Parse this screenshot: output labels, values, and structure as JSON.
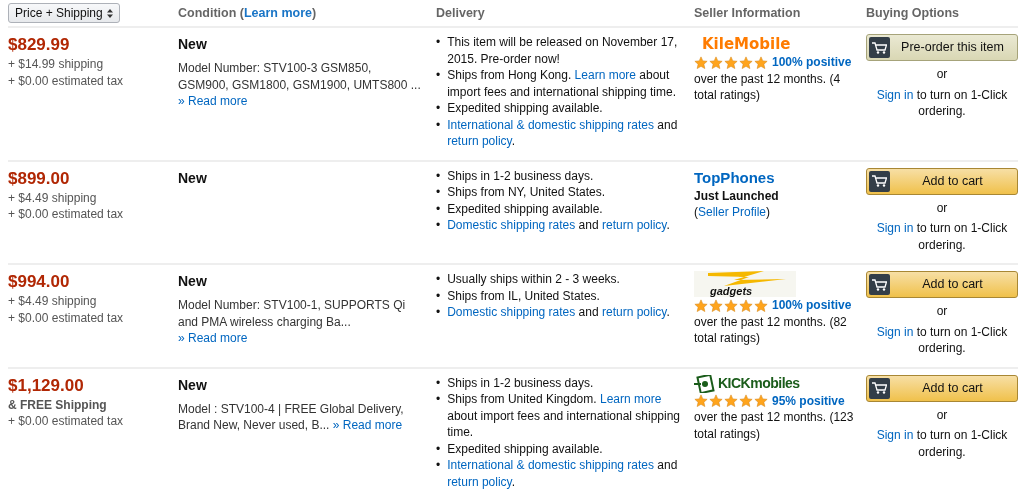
{
  "header": {
    "sort": {
      "label": "Price + Shipping"
    },
    "columns": [
      {
        "segments": [
          {
            "text": "Condition ("
          },
          {
            "text": "Learn more",
            "link": true
          },
          {
            "text": ")"
          }
        ]
      },
      {
        "segments": [
          {
            "text": "Delivery"
          }
        ]
      },
      {
        "segments": [
          {
            "text": "Seller Information"
          }
        ]
      },
      {
        "segments": [
          {
            "text": "Buying Options"
          }
        ]
      }
    ]
  },
  "offers": [
    {
      "price": "$829.99",
      "shipping": {
        "kind": "paid",
        "text": "+ $14.99 shipping"
      },
      "tax": "+ $0.00 estimated tax",
      "condition": "New",
      "description": "Model Number: STV100-3 GSM850, GSM900, GSM1800, GSM1900, UMTS800 ...",
      "read_more": "» Read more",
      "read_more_block": true,
      "delivery": [
        {
          "bullet": "•",
          "segments": [
            {
              "text": "This item will be released on November 17, 2015. Pre-order now!"
            }
          ]
        },
        {
          "bullet": "•",
          "segments": [
            {
              "text": "Ships from Hong Kong. "
            },
            {
              "text": "Learn more",
              "link": true
            },
            {
              "text": " about import fees and international shipping time."
            }
          ]
        },
        {
          "bullet": "•",
          "segments": [
            {
              "text": "Expedited shipping available."
            }
          ]
        },
        {
          "bullet": "•",
          "segments": [
            {
              "text": "International & domestic shipping rates",
              "link": true
            },
            {
              "text": " and "
            },
            {
              "text": "return policy",
              "link": true
            },
            {
              "text": "."
            }
          ]
        }
      ],
      "seller": {
        "kind": "text_logo",
        "name": "KileMobile",
        "stars": 5,
        "positive": "100% positive",
        "note": "over the past 12 months. (4 total ratings)"
      },
      "button": {
        "kind": "preorder",
        "label": "Pre-order this item"
      },
      "or": "or",
      "signin": [
        {
          "text": "Sign in",
          "link": true
        },
        {
          "text": " to turn on 1-Click ordering."
        }
      ]
    },
    {
      "price": "$899.00",
      "shipping": {
        "kind": "paid",
        "text": "+ $4.49 shipping"
      },
      "tax": "+ $0.00 estimated tax",
      "condition": "New",
      "delivery": [
        {
          "bullet": "•",
          "segments": [
            {
              "text": "Ships in 1-2 business days."
            }
          ]
        },
        {
          "bullet": "•",
          "segments": [
            {
              "text": "Ships from NY, United States."
            }
          ]
        },
        {
          "bullet": "•",
          "segments": [
            {
              "text": "Expedited shipping available."
            }
          ]
        },
        {
          "bullet": "•",
          "segments": [
            {
              "text": "Domestic shipping rates",
              "link": true
            },
            {
              "text": " and "
            },
            {
              "text": "return policy",
              "link": true
            },
            {
              "text": "."
            }
          ]
        }
      ],
      "seller": {
        "kind": "name",
        "name": "TopPhones",
        "status": [
          {
            "text": "Just Launched",
            "bold": true
          },
          {
            "text": " ("
          },
          {
            "text": "Seller Profile",
            "link": true
          },
          {
            "text": ")"
          }
        ]
      },
      "button": {
        "kind": "cart",
        "label": "Add to cart"
      },
      "or": "or",
      "signin": [
        {
          "text": "Sign in",
          "link": true
        },
        {
          "text": " to turn on 1-Click ordering."
        }
      ]
    },
    {
      "price": "$994.00",
      "shipping": {
        "kind": "paid",
        "text": "+ $4.49 shipping"
      },
      "tax": "+ $0.00 estimated tax",
      "condition": "New",
      "description": "Model Number: STV100-1, SUPPORTS Qi and PMA wireless charging Ba...",
      "read_more": "» Read more",
      "read_more_block": true,
      "delivery": [
        {
          "bullet": "•",
          "segments": [
            {
              "text": "Usually ships within 2 - 3 weeks."
            }
          ]
        },
        {
          "bullet": "•",
          "segments": [
            {
              "text": "Ships from IL, United States."
            }
          ]
        },
        {
          "bullet": "•",
          "segments": [
            {
              "text": "Domestic shipping rates",
              "link": true
            },
            {
              "text": " and "
            },
            {
              "text": "return policy",
              "link": true
            },
            {
              "text": "."
            }
          ]
        }
      ],
      "seller": {
        "kind": "banner_logo",
        "name": "gadgets",
        "stars": 5,
        "positive": "100% positive",
        "note": "over the past 12 months. (82 total ratings)"
      },
      "button": {
        "kind": "cart",
        "label": "Add to cart"
      },
      "or": "or",
      "signin": [
        {
          "text": "Sign in",
          "link": true
        },
        {
          "text": " to turn on 1-Click ordering."
        }
      ]
    },
    {
      "price": "$1,129.00",
      "shipping": {
        "kind": "free",
        "text": "& FREE Shipping"
      },
      "tax": "+ $0.00 estimated tax",
      "condition": "New",
      "description": "Model : STV100-4 | FREE Global Delivery, Brand New, Never used, B...",
      "read_more": "» Read more",
      "read_more_block": false,
      "delivery": [
        {
          "bullet": "•",
          "segments": [
            {
              "text": "Ships in 1-2 business days."
            }
          ]
        },
        {
          "bullet": "•",
          "segments": [
            {
              "text": "Ships from United Kingdom. "
            },
            {
              "text": "Learn more",
              "link": true
            },
            {
              "text": " about import fees and international shipping time."
            }
          ]
        },
        {
          "bullet": "•",
          "segments": [
            {
              "text": "Expedited shipping available."
            }
          ]
        },
        {
          "bullet": "•",
          "segments": [
            {
              "text": "International & domestic shipping rates",
              "link": true
            },
            {
              "text": " and "
            },
            {
              "text": "return policy",
              "link": true
            },
            {
              "text": "."
            }
          ]
        }
      ],
      "seller": {
        "kind": "badge_logo",
        "name": "KICKmobiles",
        "stars": 5,
        "positive": "95% positive",
        "note": "over the past 12 months. (123 total ratings)"
      },
      "button": {
        "kind": "cart",
        "label": "Add to cart"
      },
      "or": "or",
      "signin": [
        {
          "text": "Sign in",
          "link": true
        },
        {
          "text": " to turn on 1-Click ordering."
        }
      ]
    }
  ]
}
